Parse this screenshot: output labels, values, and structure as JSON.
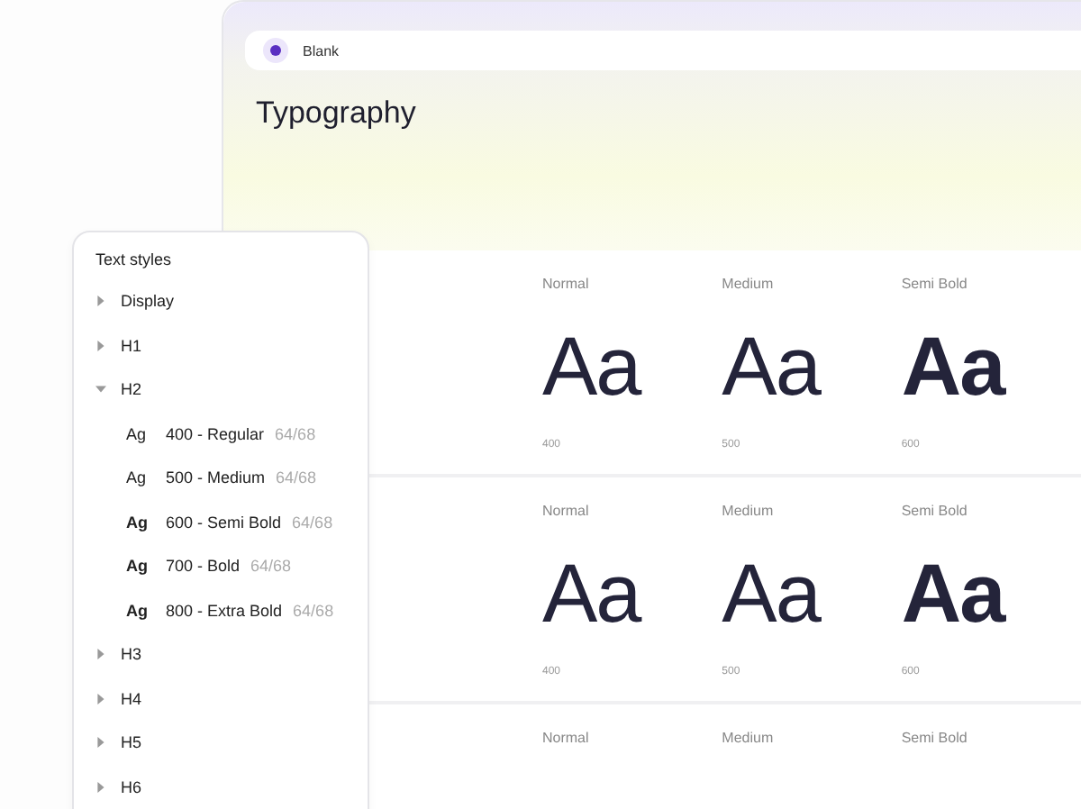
{
  "window": {
    "app_name": "Blank",
    "title": "Typography"
  },
  "rows": [
    {
      "cells": [
        {
          "label": "Normal",
          "sample": "Aa",
          "weight": "400"
        },
        {
          "label": "Medium",
          "sample": "Aa",
          "weight": "500"
        },
        {
          "label": "Semi Bold",
          "sample": "Aa",
          "weight": "600"
        }
      ]
    },
    {
      "cells": [
        {
          "label": "Normal",
          "sample": "Aa",
          "weight": "400"
        },
        {
          "label": "Medium",
          "sample": "Aa",
          "weight": "500"
        },
        {
          "label": "Semi Bold",
          "sample": "Aa",
          "weight": "600"
        }
      ]
    },
    {
      "cells": [
        {
          "label": "Normal"
        },
        {
          "label": "Medium"
        },
        {
          "label": "Semi Bold"
        }
      ]
    }
  ],
  "sidebar": {
    "title": "Text styles",
    "items": [
      {
        "label": "Display",
        "expanded": false
      },
      {
        "label": "H1",
        "expanded": false
      },
      {
        "label": "H2",
        "expanded": true,
        "children": [
          {
            "sample": "Ag",
            "name": "400 - Regular",
            "size": "64/68"
          },
          {
            "sample": "Ag",
            "name": "500 - Medium",
            "size": "64/68"
          },
          {
            "sample": "Ag",
            "name": "600 - Semi Bold",
            "size": "64/68"
          },
          {
            "sample": "Ag",
            "name": "700 - Bold",
            "size": "64/68"
          },
          {
            "sample": "Ag",
            "name": "800 - Extra Bold",
            "size": "64/68"
          }
        ]
      },
      {
        "label": "H3",
        "expanded": false
      },
      {
        "label": "H4",
        "expanded": false
      },
      {
        "label": "H5",
        "expanded": false
      },
      {
        "label": "H6",
        "expanded": false
      }
    ]
  }
}
